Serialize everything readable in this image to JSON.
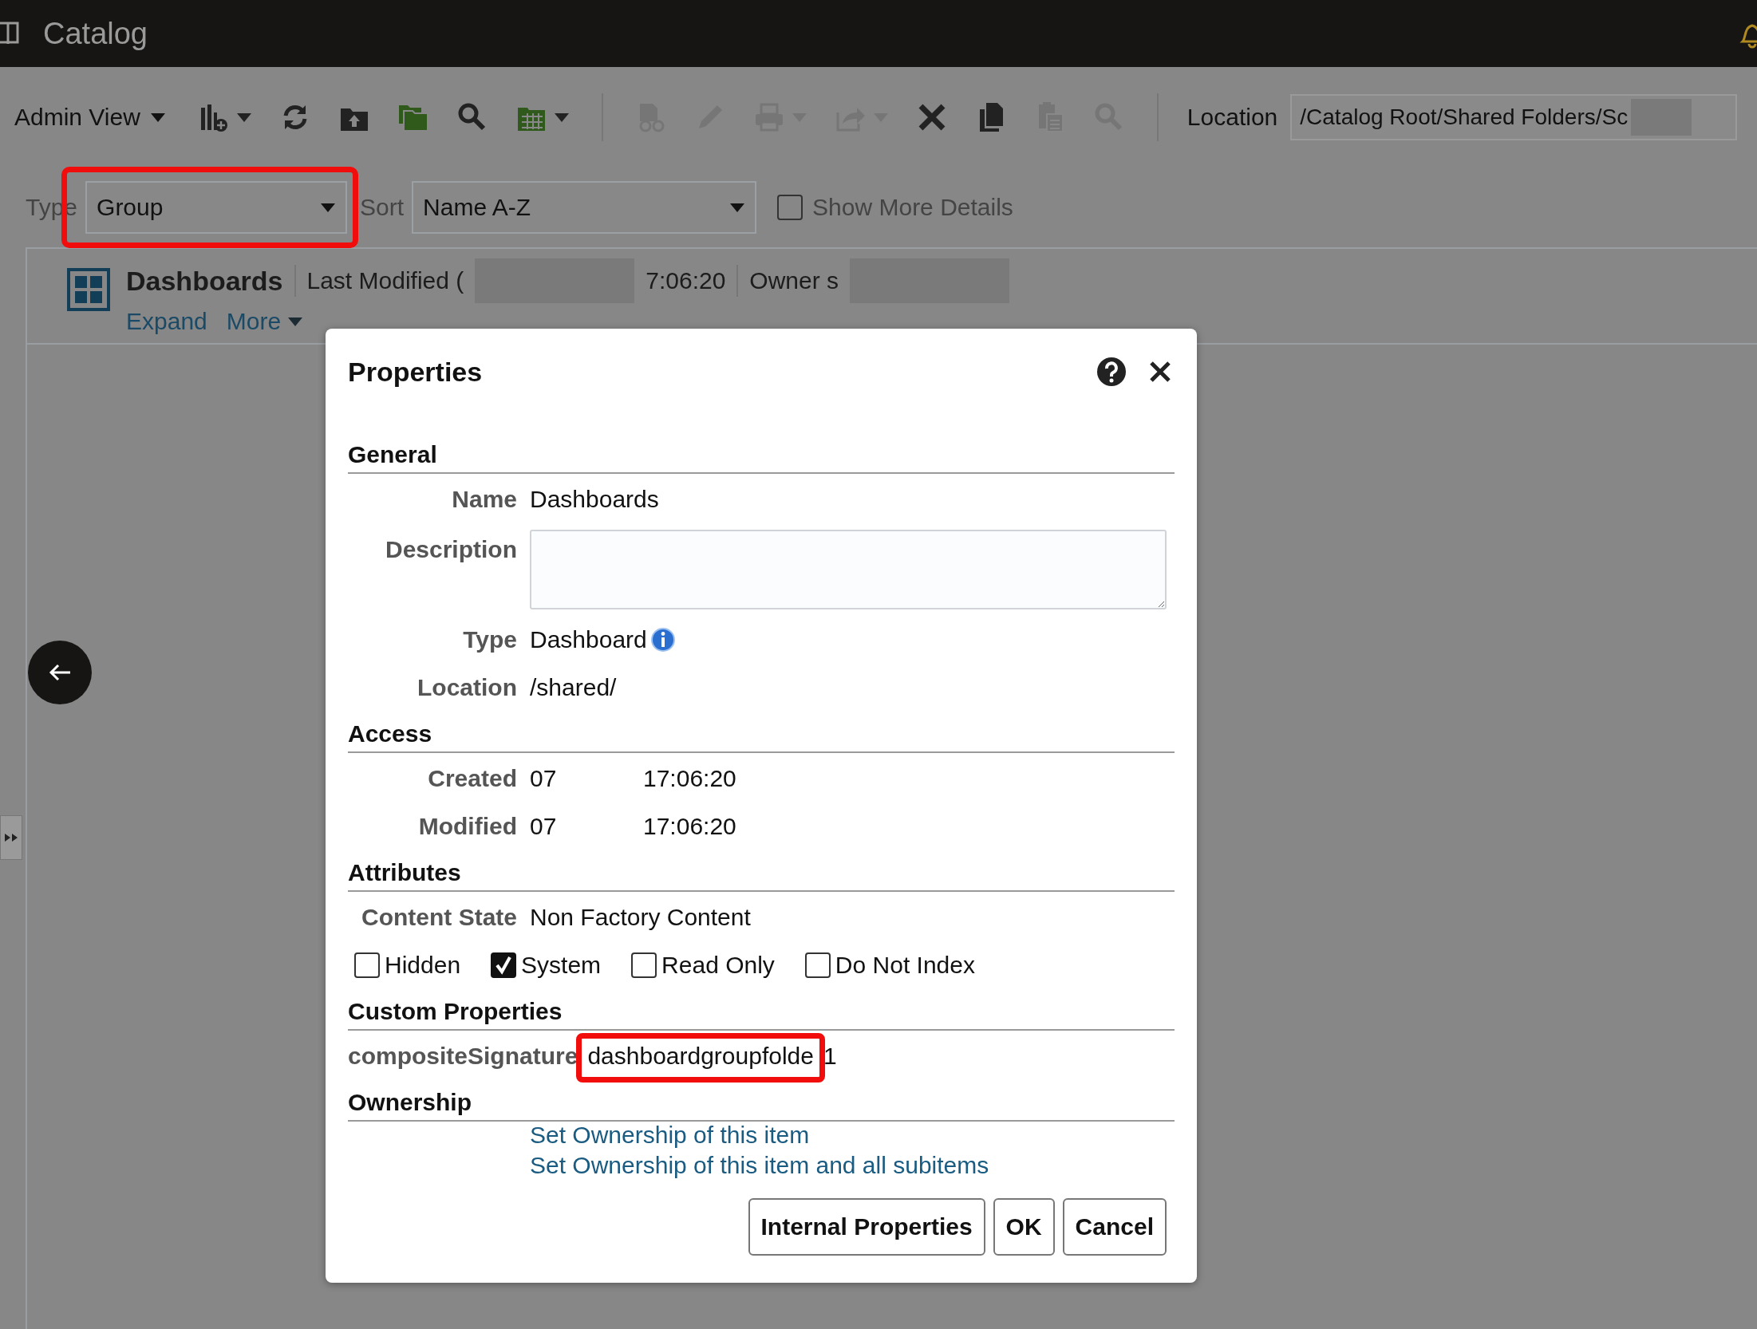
{
  "header": {
    "title": "Catalog"
  },
  "toolbar": {
    "view_menu": "Admin View",
    "tool_groups": [
      [
        {
          "kind": "chart-add",
          "disabled": false,
          "menu": true
        },
        {
          "kind": "refresh",
          "disabled": false,
          "menu": false
        },
        {
          "kind": "upload",
          "disabled": false,
          "menu": false
        },
        {
          "kind": "folders",
          "disabled": false,
          "menu": false
        },
        {
          "kind": "search",
          "disabled": false,
          "menu": false
        },
        {
          "kind": "table",
          "disabled": false,
          "menu": true
        }
      ],
      [
        {
          "kind": "sheet",
          "disabled": true,
          "menu": false
        },
        {
          "kind": "pencil",
          "disabled": true,
          "menu": false
        },
        {
          "kind": "print",
          "disabled": true,
          "menu": true
        },
        {
          "kind": "share",
          "disabled": true,
          "menu": true
        },
        {
          "kind": "delete",
          "disabled": false,
          "menu": false
        },
        {
          "kind": "copy",
          "disabled": false,
          "menu": false
        },
        {
          "kind": "paste",
          "disabled": true,
          "menu": false
        },
        {
          "kind": "search",
          "disabled": true,
          "menu": false
        }
      ]
    ],
    "location_label": "Location",
    "location_value": "/Catalog Root/Shared Folders/Sc"
  },
  "filters": {
    "type_label": "Type",
    "type_value": "Group",
    "type_highlighted": true,
    "sort_label": "Sort",
    "sort_value": "Name A-Z",
    "show_more": {
      "label": "Show More Details",
      "checked": false
    }
  },
  "item": {
    "name": "Dashboards",
    "modified_label": "Last Modified (",
    "modified_time": "7:06:20",
    "owner": "Owner s",
    "actions": [
      "Expand",
      "More"
    ]
  },
  "dialog": {
    "title": "Properties",
    "sections": [
      {
        "heading": "General",
        "rows": [
          {
            "kind": "text",
            "label": "Name",
            "value": "Dashboards"
          },
          {
            "kind": "textarea",
            "label": "Description"
          },
          {
            "kind": "info",
            "label": "Type",
            "value": "Dashboard"
          },
          {
            "kind": "text",
            "label": "Location",
            "value": "/shared/"
          }
        ]
      },
      {
        "heading": "Access",
        "rows": [
          {
            "kind": "datetime",
            "label": "Created",
            "date": "07",
            "time": "17:06:20"
          },
          {
            "kind": "datetime",
            "label": "Modified",
            "date": "07",
            "time": "17:06:20"
          }
        ]
      },
      {
        "heading": "Attributes",
        "rows": [
          {
            "kind": "text",
            "label": "Content State",
            "value": "Non Factory Content"
          },
          {
            "kind": "checkboxes",
            "items": [
              {
                "label": "Hidden",
                "checked": false
              },
              {
                "label": "System",
                "checked": true
              },
              {
                "label": "Read Only",
                "checked": false
              },
              {
                "label": "Do Not Index",
                "checked": false
              }
            ]
          }
        ]
      },
      {
        "heading": "Custom Properties",
        "rows": [
          {
            "kind": "custom",
            "label": "compositeSignature",
            "value": "dashboardgroupfolde",
            "suffix": "1",
            "highlighted": true
          }
        ]
      },
      {
        "heading": "Ownership",
        "rows": [
          {
            "kind": "links",
            "items": [
              "Set Ownership of this item",
              "Set Ownership of this item and all subitems"
            ]
          }
        ]
      }
    ],
    "buttons": [
      "Internal Properties",
      "OK",
      "Cancel"
    ]
  }
}
